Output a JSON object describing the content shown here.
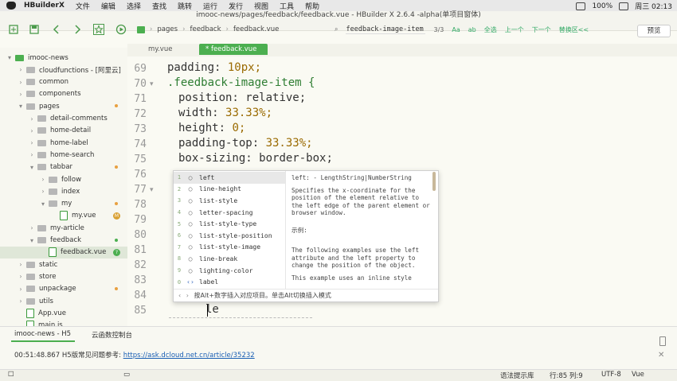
{
  "menubar": {
    "app_name": "HBuilderX",
    "menus": [
      "文件",
      "编辑",
      "选择",
      "查找",
      "跳转",
      "运行",
      "发行",
      "视图",
      "工具",
      "帮助"
    ],
    "battery": "100%",
    "datetime": "周三 02:13"
  },
  "window": {
    "title": "imooc-news/pages/feedback/feedback.vue - HBuilder X 2.6.4 -alpha(单项目窗体)"
  },
  "breadcrumb": {
    "items": [
      "pages",
      "feedback",
      "feedback.vue"
    ]
  },
  "search": {
    "query": "feedback-image-item",
    "count": "3/3",
    "options": [
      "Aa",
      "ab",
      "全选",
      "上一个",
      "下一个",
      "替换区<<"
    ]
  },
  "toolbar": {
    "preview_label": "预览"
  },
  "sidebar": {
    "items": [
      {
        "label": "imooc-news",
        "level": 0,
        "type": "project",
        "open": true
      },
      {
        "label": "cloudfunctions - [阿里云]",
        "level": 1,
        "type": "folder"
      },
      {
        "label": "common",
        "level": 1,
        "type": "folder"
      },
      {
        "label": "components",
        "level": 1,
        "type": "folder"
      },
      {
        "label": "pages",
        "level": 1,
        "type": "folder",
        "open": true,
        "dot": "#e8a040"
      },
      {
        "label": "detail-comments",
        "level": 2,
        "type": "folder"
      },
      {
        "label": "home-detail",
        "level": 2,
        "type": "folder"
      },
      {
        "label": "home-label",
        "level": 2,
        "type": "folder"
      },
      {
        "label": "home-search",
        "level": 2,
        "type": "folder"
      },
      {
        "label": "tabbar",
        "level": 2,
        "type": "folder",
        "open": true,
        "dot": "#e8a040"
      },
      {
        "label": "follow",
        "level": 3,
        "type": "folder"
      },
      {
        "label": "index",
        "level": 3,
        "type": "folder"
      },
      {
        "label": "my",
        "level": 3,
        "type": "folder",
        "open": true,
        "dot": "#e8a040"
      },
      {
        "label": "my.vue",
        "level": 4,
        "type": "file",
        "badge": "M",
        "badge_color": "#d9a030"
      },
      {
        "label": "my-article",
        "level": 2,
        "type": "folder"
      },
      {
        "label": "feedback",
        "level": 2,
        "type": "folder",
        "open": true,
        "dot": "#4caf50"
      },
      {
        "label": "feedback.vue",
        "level": 3,
        "type": "file",
        "selected": true,
        "badge": "?",
        "badge_color": "#4caf50"
      },
      {
        "label": "static",
        "level": 1,
        "type": "folder"
      },
      {
        "label": "store",
        "level": 1,
        "type": "folder"
      },
      {
        "label": "unpackage",
        "level": 1,
        "type": "folder",
        "dot": "#e8a040"
      },
      {
        "label": "utils",
        "level": 1,
        "type": "folder"
      },
      {
        "label": "App.vue",
        "level": 1,
        "type": "file"
      },
      {
        "label": "main.js",
        "level": 1,
        "type": "file"
      }
    ]
  },
  "tabs": [
    {
      "label": "my.vue",
      "active": false
    },
    {
      "label": "* feedback.vue",
      "active": true
    }
  ],
  "editor": {
    "lines": [
      {
        "n": "69",
        "text": "padding: 10px;"
      },
      {
        "n": "70",
        "text": ".feedback-image-item {"
      },
      {
        "n": "71",
        "text": "position: relative;"
      },
      {
        "n": "72",
        "text": "width: 33.33%;"
      },
      {
        "n": "73",
        "text": "height: 0;"
      },
      {
        "n": "74",
        "text": "padding-top: 33.33%;"
      },
      {
        "n": "75",
        "text": "box-sizing: border-box;"
      },
      {
        "n": "76",
        "text": ""
      },
      {
        "n": "77",
        "text": ""
      },
      {
        "n": "78",
        "text": ""
      },
      {
        "n": "79",
        "text": ""
      },
      {
        "n": "80",
        "text": ""
      },
      {
        "n": "81",
        "text": ""
      },
      {
        "n": "82",
        "text": ""
      },
      {
        "n": "83",
        "text": ""
      },
      {
        "n": "84",
        "text": ""
      },
      {
        "n": "85",
        "text": "le"
      }
    ]
  },
  "autocomplete": {
    "items": [
      {
        "n": "1",
        "label": "left",
        "active": true
      },
      {
        "n": "2",
        "label": "line-height"
      },
      {
        "n": "3",
        "label": "list-style"
      },
      {
        "n": "4",
        "label": "letter-spacing"
      },
      {
        "n": "5",
        "label": "list-style-type"
      },
      {
        "n": "6",
        "label": "list-style-position"
      },
      {
        "n": "7",
        "label": "list-style-image"
      },
      {
        "n": "8",
        "label": "line-break"
      },
      {
        "n": "9",
        "label": "lighting-color"
      },
      {
        "n": "0",
        "label": "label",
        "icon": "<>"
      }
    ],
    "doc_sig": "left: - LengthString|NumberString",
    "doc_desc": "Specifies the x-coordinate for the position of the element relative to the left edge of the parent element or browser window.",
    "doc_example_label": "示例:",
    "doc_example": "The following examples use the left attribute and the left property to change the position of the object.",
    "doc_more": "This example uses an inline style",
    "footer": "按Alt+数字插入对应项目。单击Alt切换插入模式"
  },
  "panel": {
    "tabs": [
      "imooc-news - H5",
      "云函数控制台"
    ],
    "log_time": "00:51:48.867",
    "log_text": "H5版常见问题参考:",
    "log_link": "https://ask.dcloud.net.cn/article/35232"
  },
  "statusbar": {
    "hint": "语法提示库",
    "position": "行:85  列:9",
    "encoding": "UTF-8",
    "lang": "Vue"
  },
  "colors": {
    "accent": "#4caf50",
    "selector": "#2e7d32",
    "number": "#9a6a00"
  }
}
